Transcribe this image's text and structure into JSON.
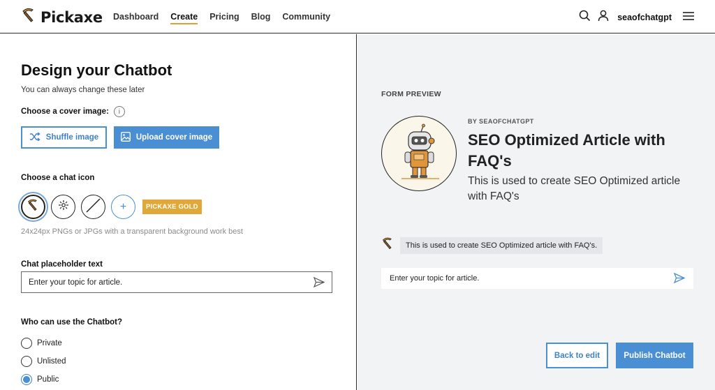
{
  "header": {
    "logo_text": "Pickaxe",
    "nav": [
      {
        "label": "Dashboard",
        "active": false
      },
      {
        "label": "Create",
        "active": true
      },
      {
        "label": "Pricing",
        "active": false
      },
      {
        "label": "Blog",
        "active": false
      },
      {
        "label": "Community",
        "active": false
      }
    ],
    "username": "seaofchatgpt"
  },
  "design": {
    "title": "Design your Chatbot",
    "subtitle": "You can always change these later",
    "cover_label": "Choose a cover image:",
    "shuffle_label": "Shuffle image",
    "upload_label": "Upload cover image",
    "chat_icon_label": "Choose a chat icon",
    "gold_badge": "PICKAXE GOLD",
    "icon_hint": "24x24px PNGs or JPGs with a transparent background work best",
    "placeholder_label": "Chat placeholder text",
    "placeholder_value": "Enter your topic for article.",
    "who_label": "Who can use the Chatbot?",
    "access_options": [
      {
        "label": "Private",
        "checked": false
      },
      {
        "label": "Unlisted",
        "checked": false
      },
      {
        "label": "Public",
        "checked": true
      }
    ]
  },
  "preview": {
    "label": "FORM PREVIEW",
    "byline": "BY SEAOFCHATGPT",
    "bot_title": "SEO Optimized Article with FAQ's",
    "bot_description": "This is used to create  SEO Optimized article with FAQ's",
    "intro_message": "This is used to create SEO Optimized article with FAQ's.",
    "chat_placeholder": "Enter your topic for article.",
    "back_label": "Back to edit",
    "publish_label": "Publish Chatbot"
  },
  "colors": {
    "accent": "#4a8fd4",
    "gold": "#e0a838",
    "nav_underline": "#e0a030",
    "preview_bg": "#f1f3f4"
  },
  "icons": [
    "pickaxe-icon",
    "search-icon",
    "user-icon",
    "menu-icon",
    "info-icon",
    "shuffle-icon",
    "image-icon",
    "sparkle-icon",
    "no-icon",
    "plus-icon",
    "send-icon"
  ]
}
